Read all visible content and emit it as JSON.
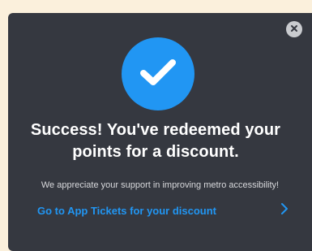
{
  "dialog": {
    "title": "Success! You've redeemed your points for a discount.",
    "subtitle": "We appreciate your support in improving metro accessibility!",
    "cta_label": "Go to App Tickets for your discount",
    "icons": {
      "close": "close-icon",
      "success": "checkmark-icon",
      "cta": "chevron-right-icon"
    }
  },
  "colors": {
    "background": "#fbf0dc",
    "dialog": "#353840",
    "accent": "#2196f3",
    "text": "#ffffff",
    "muted_text": "#d8d9dc",
    "close_button": "#c9cbcf"
  }
}
